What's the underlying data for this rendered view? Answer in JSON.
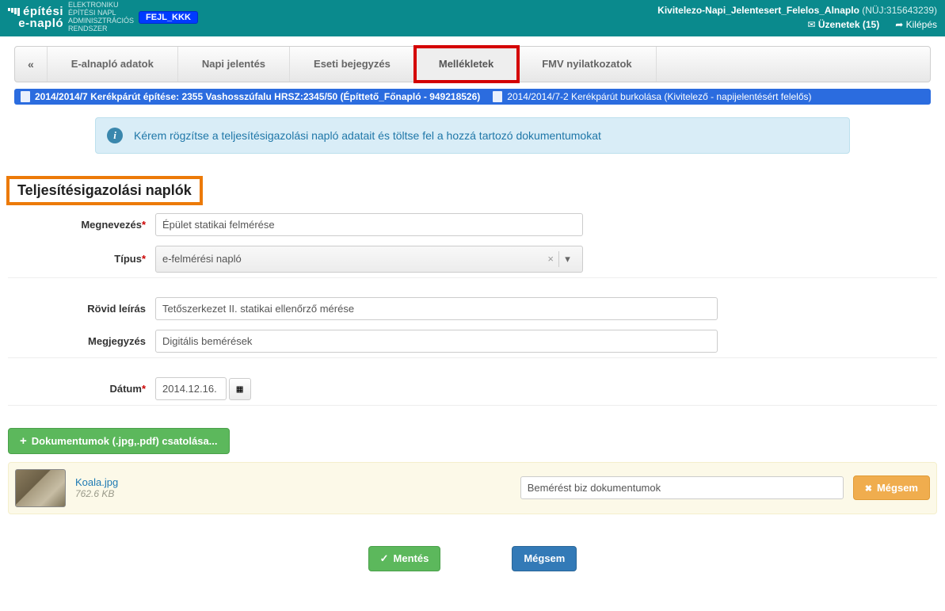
{
  "header": {
    "logo_l1": "építési",
    "logo_l2": "e-napló",
    "logo_sub1": "ELEKTRONIKU",
    "logo_sub2": "ÉPÍTÉSI NAPL",
    "logo_sub3": "ADMINISZTRÁCIÓS",
    "logo_sub4": "RENDSZER",
    "env": "FEJL_KKK",
    "user": "Kivitelezo-Napi_Jelentesert_Felelos_Alnaplo",
    "user_id": "(NÜJ:315643239)",
    "messages": "Üzenetek (15)",
    "logout": "Kilépés",
    "mail_icon": "✉",
    "exit_icon": "➦"
  },
  "tabs": {
    "back": "«",
    "t1": "E-alnapló adatok",
    "t2": "Napi jelentés",
    "t3": "Eseti bejegyzés",
    "t4": "Mellékletek",
    "t5": "FMV nyilatkozatok"
  },
  "crumb": {
    "c1": "2014/2014/7 Kerékpárút építése: 2355 Vashosszúfalu HRSZ:2345/50 (Építtető_Főnapló - 949218526)",
    "c2": "2014/2014/7-2 Kerékpárút burkolása (Kivitelező - napijelentésért felelős)"
  },
  "alert": "Kérem rögzítse a teljesítésigazolási napló adatait és töltse fel a hozzá tartozó dokumentumokat",
  "section": "Teljesítésigazolási naplók",
  "form": {
    "megnevezes_lbl": "Megnevezés",
    "megnevezes_val": "Épület statikai felmérése",
    "tipus_lbl": "Típus",
    "tipus_val": "e-felmérési napló",
    "rovid_lbl": "Rövid leírás",
    "rovid_val": "Tetőszerkezet II. statikai ellenőrző mérése",
    "megjegyzes_lbl": "Megjegyzés",
    "megjegyzes_val": "Digitális bemérések",
    "datum_lbl": "Dátum",
    "datum_val": "2014.12.16."
  },
  "attach": {
    "btn": "Dokumentumok (.jpg,.pdf) csatolása...",
    "fname": "Koala.jpg",
    "fsize": "762.6 KB",
    "desc": "Bemérést biz dokumentumok",
    "cancel": "Mégsem"
  },
  "actions": {
    "save": "Mentés",
    "cancel": "Mégsem"
  }
}
